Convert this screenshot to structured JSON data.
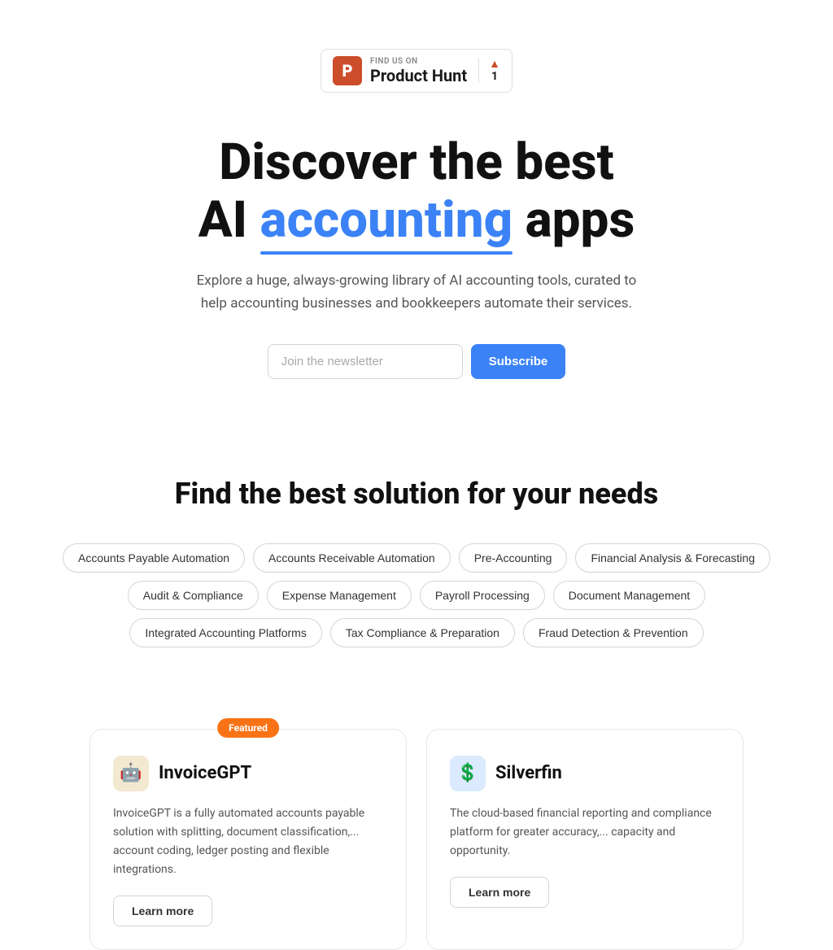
{
  "producthunt": {
    "find_us_label": "FIND US ON",
    "name": "Product Hunt",
    "vote_count": "1"
  },
  "hero": {
    "title_line1": "Discover the best",
    "title_line2_prefix": "AI ",
    "title_accent": "accounting",
    "title_line2_suffix": " apps",
    "subtitle": "Explore a huge, always-growing library of AI accounting tools, curated to help accounting businesses and bookkeepers automate their services."
  },
  "newsletter": {
    "placeholder": "Join the newsletter",
    "button_label": "Subscribe"
  },
  "solution": {
    "title": "Find the best solution for your needs"
  },
  "tags": [
    {
      "label": "Accounts Payable Automation"
    },
    {
      "label": "Accounts Receivable Automation"
    },
    {
      "label": "Pre-Accounting"
    },
    {
      "label": "Financial Analysis & Forecasting"
    },
    {
      "label": "Audit & Compliance"
    },
    {
      "label": "Expense Management"
    },
    {
      "label": "Payroll Processing"
    },
    {
      "label": "Document Management"
    },
    {
      "label": "Integrated Accounting Platforms"
    },
    {
      "label": "Tax Compliance & Preparation"
    },
    {
      "label": "Fraud Detection & Prevention"
    }
  ],
  "cards": [
    {
      "featured": true,
      "featured_label": "Featured",
      "logo_emoji": "🤖",
      "title": "InvoiceGPT",
      "description": "InvoiceGPT is a fully automated accounts payable solution with splitting, document classification,... account coding, ledger posting and flexible integrations.",
      "button_label": "Learn more"
    },
    {
      "featured": false,
      "featured_label": "",
      "logo_emoji": "💲",
      "title": "Silverfin",
      "description": "The cloud-based financial reporting and compliance platform for greater accuracy,... capacity and opportunity.",
      "button_label": "Learn more"
    }
  ]
}
